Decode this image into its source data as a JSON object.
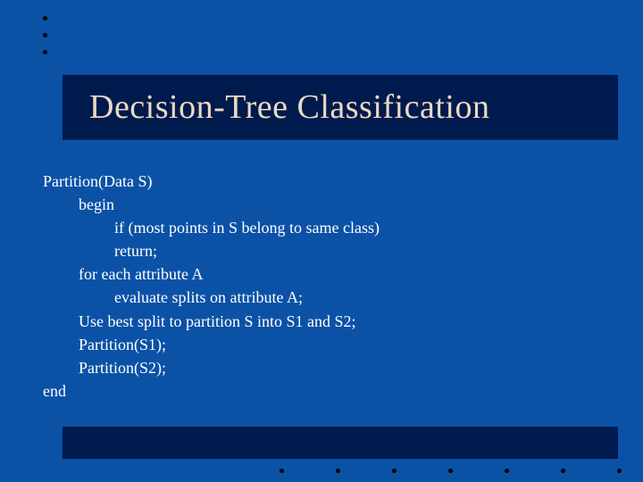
{
  "title": "Decision-Tree Classification",
  "algorithm": {
    "lines": [
      {
        "indent": 0,
        "text": "Partition(Data S)"
      },
      {
        "indent": 1,
        "text": "begin"
      },
      {
        "indent": 2,
        "text": "if (most points in S belong to same class)"
      },
      {
        "indent": 2,
        "text": "return;"
      },
      {
        "indent": 1,
        "text": "for each attribute A"
      },
      {
        "indent": 2,
        "text": "evaluate splits on attribute A;"
      },
      {
        "indent": 1,
        "text": "Use best split to partition S into S1 and S2;"
      },
      {
        "indent": 1,
        "text": "Partition(S1);"
      },
      {
        "indent": 1,
        "text": "Partition(S2);"
      },
      {
        "indent": 0,
        "text": "end"
      }
    ]
  },
  "decoration": {
    "top_bullets": 3,
    "bottom_bullets": 7
  },
  "colors": {
    "background": "#0b52a7",
    "bar": "#001a4d",
    "title_text": "#e9d9c3",
    "body_text": "#ffffff"
  }
}
